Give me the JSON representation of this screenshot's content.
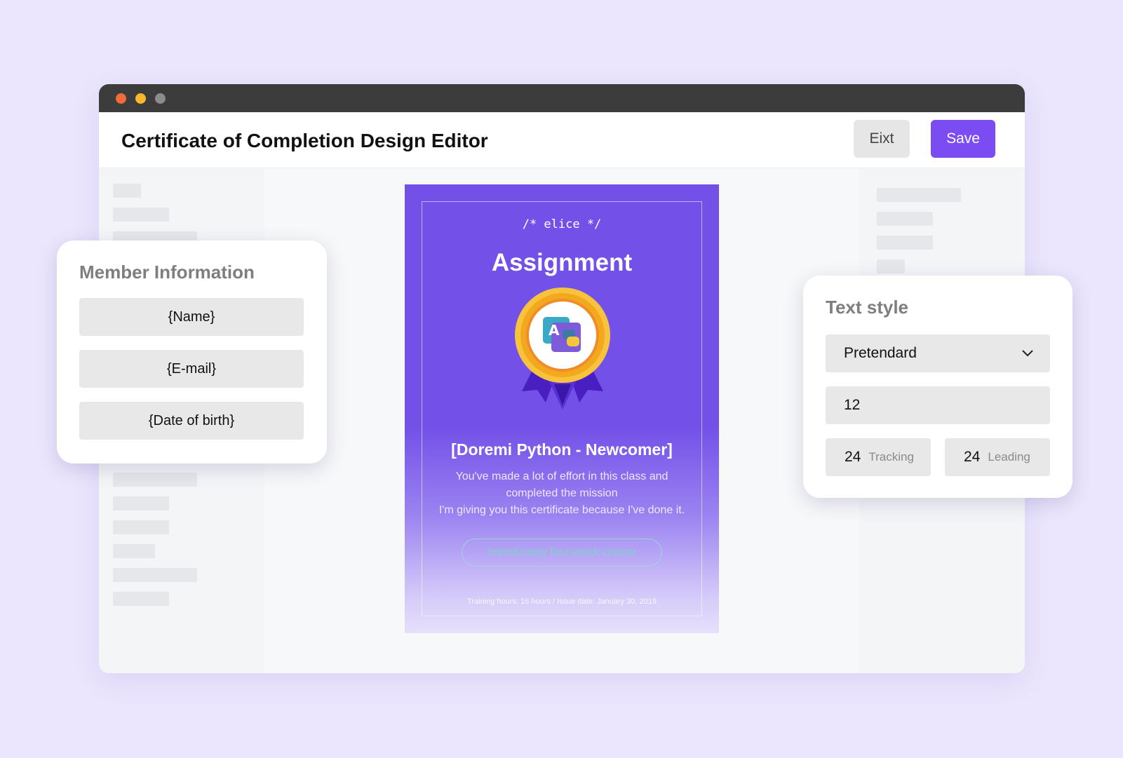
{
  "window": {
    "title": "Certificate of Completion Design Editor",
    "exit_label": "Eixt",
    "save_label": "Save"
  },
  "certificate": {
    "logo": "/* elice */",
    "heading": "Assignment",
    "course": "[Doremi Python - Newcomer]",
    "body_line1": "You've made a lot of effort in this class and",
    "body_line2": "completed the mission",
    "body_line3": "I'm giving you this certificate because I've done it.",
    "pill": "Introductory four-week course",
    "footer": "Training hours: 16 hours / Issue date: January 30, 2019",
    "badge_icon": "python-course-badge-icon"
  },
  "member_info": {
    "title": "Member Information",
    "fields": [
      "{Name}",
      "{E-mail}",
      "{Date of birth}"
    ]
  },
  "text_style": {
    "title": "Text style",
    "font": "Pretendard",
    "size": "12",
    "tracking_value": "24",
    "tracking_label": "Tracking",
    "leading_value": "24",
    "leading_label": "Leading"
  },
  "colors": {
    "background": "#ebe6fd",
    "accent": "#7b4cf1",
    "certificate": "#7350e8",
    "badge_gold": "#f6b92b",
    "ribbon": "#4a1fc2"
  }
}
